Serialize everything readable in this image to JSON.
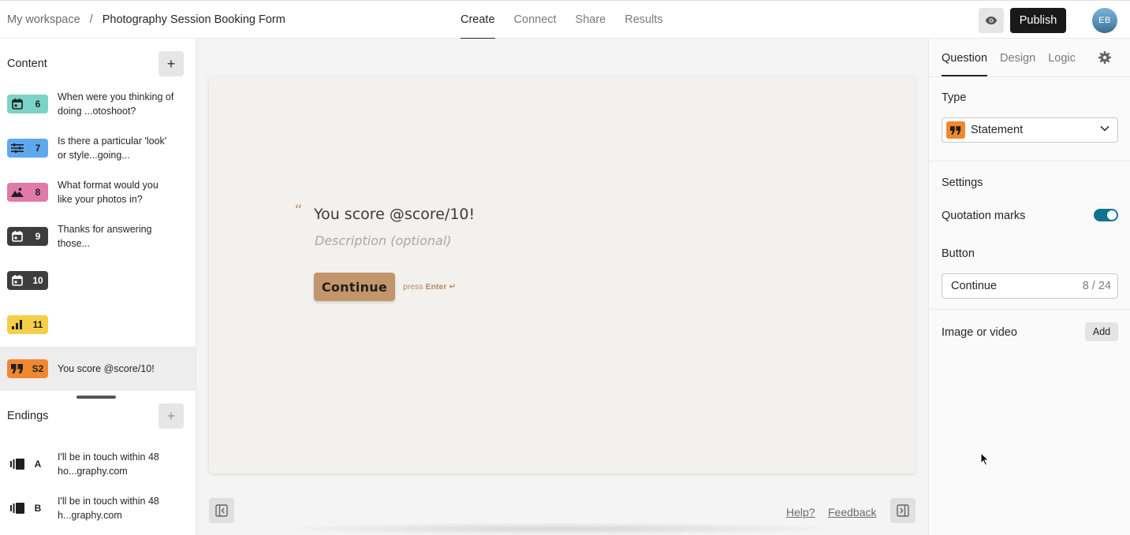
{
  "header": {
    "workspace": "My workspace",
    "separator": "/",
    "form_title": "Photography Session Booking Form",
    "tabs": [
      {
        "label": "Create",
        "active": true
      },
      {
        "label": "Connect",
        "active": false
      },
      {
        "label": "Share",
        "active": false
      },
      {
        "label": "Results",
        "active": false
      }
    ],
    "preview_icon": "eye-icon",
    "publish_label": "Publish",
    "avatar_initials": "EB"
  },
  "sidebar": {
    "content_title": "Content",
    "add_symbol": "+",
    "questions": [
      {
        "number": "6",
        "icon": "calendar-icon",
        "color": "#7bd3c8",
        "text": "When were you thinking of doing ...otoshoot?",
        "selected": false
      },
      {
        "number": "7",
        "icon": "sliders-icon",
        "color": "#5fa8ee",
        "text": "Is there a particular 'look' or style...going...",
        "selected": false
      },
      {
        "number": "8",
        "icon": "picture-choice-icon",
        "color": "#e07aa6",
        "text": "What format would you like your photos in?",
        "selected": false
      },
      {
        "number": "9",
        "icon": "calendar-icon",
        "color": "#3d3d3d",
        "text": "Thanks for answering those...",
        "selected": false
      },
      {
        "number": "10",
        "icon": "calendar-icon",
        "color": "#3d3d3d",
        "text": "",
        "selected": false
      },
      {
        "number": "11",
        "icon": "bar-chart-icon",
        "color": "#f5cf4a",
        "text": "",
        "selected": false
      },
      {
        "number": "S2",
        "icon": "quote-icon",
        "color": "#f0882f",
        "text": "You score @score/10!",
        "selected": true
      }
    ],
    "endings_title": "Endings",
    "endings": [
      {
        "letter": "A",
        "icon": "ending-icon",
        "text": "I'll be in touch within 48 ho...graphy.com"
      },
      {
        "letter": "B",
        "icon": "ending-icon",
        "text": "I'll be in touch within 48 h...graphy.com"
      }
    ]
  },
  "canvas": {
    "quote_glyph": "“",
    "title": "You score @score/10!",
    "description_placeholder": "Description (optional)",
    "button_label": "Continue",
    "press_text": "press",
    "enter_text": "Enter ↵",
    "help_link": "Help?",
    "feedback_link": "Feedback",
    "accent_color": "#c3956a"
  },
  "right_panel": {
    "tabs": [
      {
        "label": "Question",
        "active": true
      },
      {
        "label": "Design",
        "active": false
      },
      {
        "label": "Logic",
        "active": false
      }
    ],
    "type_label": "Type",
    "type_value": "Statement",
    "settings_label": "Settings",
    "quotation_marks_label": "Quotation marks",
    "quotation_marks_on": true,
    "button_label": "Button",
    "button_value": "Continue",
    "button_count": "8 / 24",
    "image_label": "Image or video",
    "add_label": "Add"
  }
}
